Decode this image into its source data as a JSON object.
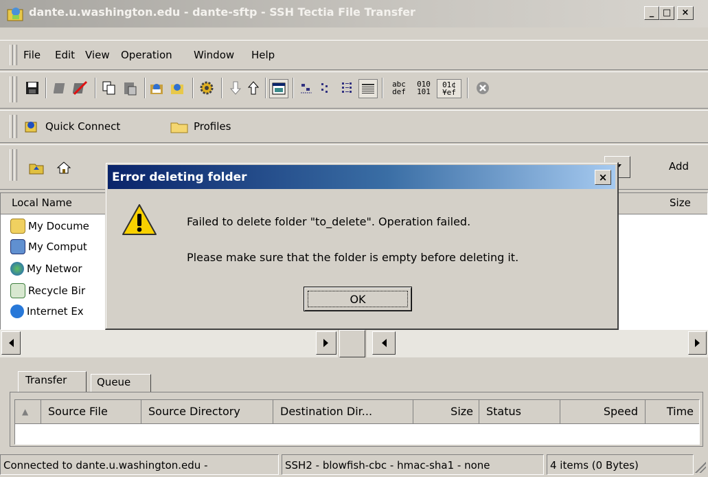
{
  "window": {
    "title": "dante.u.washington.edu - dante-sftp - SSH Tectia File Transfer",
    "min_label": "_",
    "max_label": "□",
    "close_label": "×"
  },
  "menu": [
    "File",
    "Edit",
    "View",
    "Operation",
    "Window",
    "Help"
  ],
  "toolbar_icons": [
    "save-icon",
    "disconnect-icon",
    "disconnect-all-icon",
    "copy-icon",
    "paste-icon",
    "new-connection-icon",
    "settings-icon",
    "gear-icon",
    "download-icon",
    "upload-icon",
    "file-view-icon",
    "large-icons-icon",
    "small-icons-icon",
    "list-icon",
    "details-icon",
    "ascii-mode-icon",
    "binary-mode-icon",
    "auto-mode-icon",
    "stop-icon"
  ],
  "toolbar_text": {
    "ascii": "abc\ndef",
    "binary": "010\n101",
    "auto": "01¢\n¥ef"
  },
  "quickbar": {
    "quick_connect": "Quick Connect",
    "profiles": "Profiles"
  },
  "address": {
    "add_label": "Add"
  },
  "local_pane": {
    "header": "Local Name",
    "items": [
      {
        "label": "My Docume",
        "icon": "folder-documents-icon"
      },
      {
        "label": "My Comput",
        "icon": "computer-icon"
      },
      {
        "label": "My Networ",
        "icon": "network-icon"
      },
      {
        "label": "Recycle Bir",
        "icon": "recycle-bin-icon"
      },
      {
        "label": "Internet Ex",
        "icon": "internet-explorer-icon"
      }
    ]
  },
  "remote_pane": {
    "size_header": "Size"
  },
  "tabs": [
    "Transfer",
    "Queue"
  ],
  "transfer_columns": [
    "Source File",
    "Source Directory",
    "Destination Dir...",
    "Size",
    "Status",
    "Speed",
    "Time"
  ],
  "status_bar": [
    "Connected to dante.u.washington.edu -",
    "SSH2 - blowfish-cbc - hmac-sha1 - none",
    "4 items (0 Bytes)"
  ],
  "dialog": {
    "title": "Error deleting folder",
    "message1": "Failed to delete folder \"to_delete\". Operation failed.",
    "message2": "Please make sure that the folder is empty before deleting it.",
    "ok_label": "OK",
    "close_label": "×"
  },
  "colors": {
    "face": "#d4d0c8",
    "dialog_title_start": "#0a246a",
    "dialog_title_end": "#a6caf0",
    "warning": "#f8d000"
  }
}
